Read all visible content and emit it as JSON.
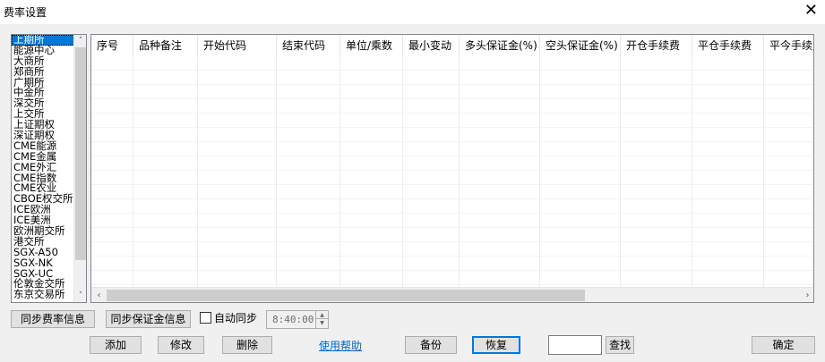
{
  "window": {
    "title": "费率设置",
    "close_glyph": "✕"
  },
  "exchanges": {
    "selected_index": 0,
    "items": [
      "上期所",
      "能源中心",
      "大商所",
      "郑商所",
      "广期所",
      "中金所",
      "深交所",
      "上交所",
      "上证期权",
      "深证期权",
      "CME能源",
      "CME金属",
      "CME外汇",
      "CME指数",
      "CME农业",
      "CBOE权交所",
      "ICE欧洲",
      "ICE美洲",
      "欧洲期交所",
      "港交所",
      "SGX-A50",
      "SGX-NK",
      "SGX-UC",
      "伦敦金交所",
      "东京交易所"
    ]
  },
  "table": {
    "columns": [
      "序号",
      "品种备注",
      "开始代码",
      "结束代码",
      "单位/乘数",
      "最小变动",
      "多头保证金(%)",
      "空头保证金(%)",
      "开仓手续费",
      "平仓手续费",
      "平今手续费"
    ],
    "rows": []
  },
  "toolbar": {
    "sync_fee": "同步费率信息",
    "sync_margin": "同步保证金信息",
    "auto_sync_label": "自动同步",
    "auto_sync_checked": false,
    "sync_time": "8:40:00",
    "add": "添加",
    "modify": "修改",
    "delete": "删除",
    "help": "使用帮助",
    "backup": "备份",
    "restore": "恢复",
    "search_value": "",
    "search": "查找",
    "ok": "确定"
  },
  "icons": {
    "up": "▲",
    "down": "▼",
    "left": "◀",
    "right": "▶",
    "scroll_up": "˄",
    "scroll_down": "˅",
    "scroll_left": "‹",
    "scroll_right": "›"
  },
  "colors": {
    "selection": "#0078d7",
    "link": "#0066cc",
    "window_bg": "#f0f0f0"
  }
}
